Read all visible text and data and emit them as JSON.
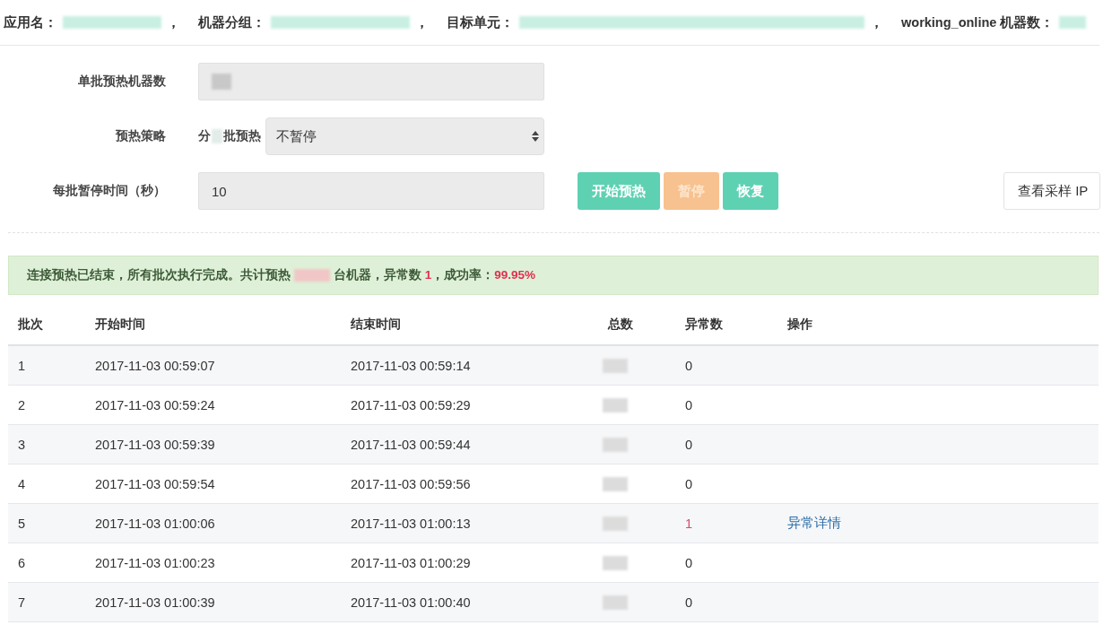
{
  "header": {
    "fields": [
      {
        "label": "应用名：",
        "separator": "，"
      },
      {
        "label": "机器分组：",
        "separator": "，"
      },
      {
        "label": "目标单元：",
        "separator": "，"
      },
      {
        "label": "working_online 机器数："
      }
    ]
  },
  "form": {
    "batch_size": {
      "label": "单批预热机器数"
    },
    "strategy": {
      "label": "预热策略",
      "prefix": "分",
      "suffix": "批预热",
      "value": "不暂停"
    },
    "pause_time": {
      "label": "每批暂停时间（秒）",
      "value": "10"
    }
  },
  "buttons": [
    {
      "label": "开始预热",
      "kind": "primary",
      "disabled": false
    },
    {
      "label": "暂停",
      "kind": "warning",
      "disabled": true
    },
    {
      "label": "恢复",
      "kind": "primary",
      "disabled": false
    },
    {
      "label": "查看采样 IP",
      "kind": "default",
      "disabled": false
    }
  ],
  "alert": {
    "before": "连接预热已结束，所有批次执行完成。共计预热",
    "after": "台机器，异常数 **1**，成功率：**99.95%**"
  },
  "table": {
    "columns": [
      "批次",
      "开始时间",
      "结束时间",
      "总数",
      "异常数",
      "操作"
    ],
    "rows": [
      {
        "batch": "1",
        "start": "2017-11-03 00:59:07",
        "end": "2017-11-03 00:59:14",
        "errors": "0",
        "abnormal": false
      },
      {
        "batch": "2",
        "start": "2017-11-03 00:59:24",
        "end": "2017-11-03 00:59:29",
        "errors": "0",
        "abnormal": false
      },
      {
        "batch": "3",
        "start": "2017-11-03 00:59:39",
        "end": "2017-11-03 00:59:44",
        "errors": "0",
        "abnormal": false
      },
      {
        "batch": "4",
        "start": "2017-11-03 00:59:54",
        "end": "2017-11-03 00:59:56",
        "errors": "0",
        "abnormal": false
      },
      {
        "batch": "5",
        "start": "2017-11-03 01:00:06",
        "end": "2017-11-03 01:00:13",
        "errors": "1",
        "abnormal": true,
        "action": "异常详情"
      },
      {
        "batch": "6",
        "start": "2017-11-03 01:00:23",
        "end": "2017-11-03 01:00:29",
        "errors": "0",
        "abnormal": false
      },
      {
        "batch": "7",
        "start": "2017-11-03 01:00:39",
        "end": "2017-11-03 01:00:40",
        "errors": "0",
        "abnormal": false
      }
    ]
  }
}
